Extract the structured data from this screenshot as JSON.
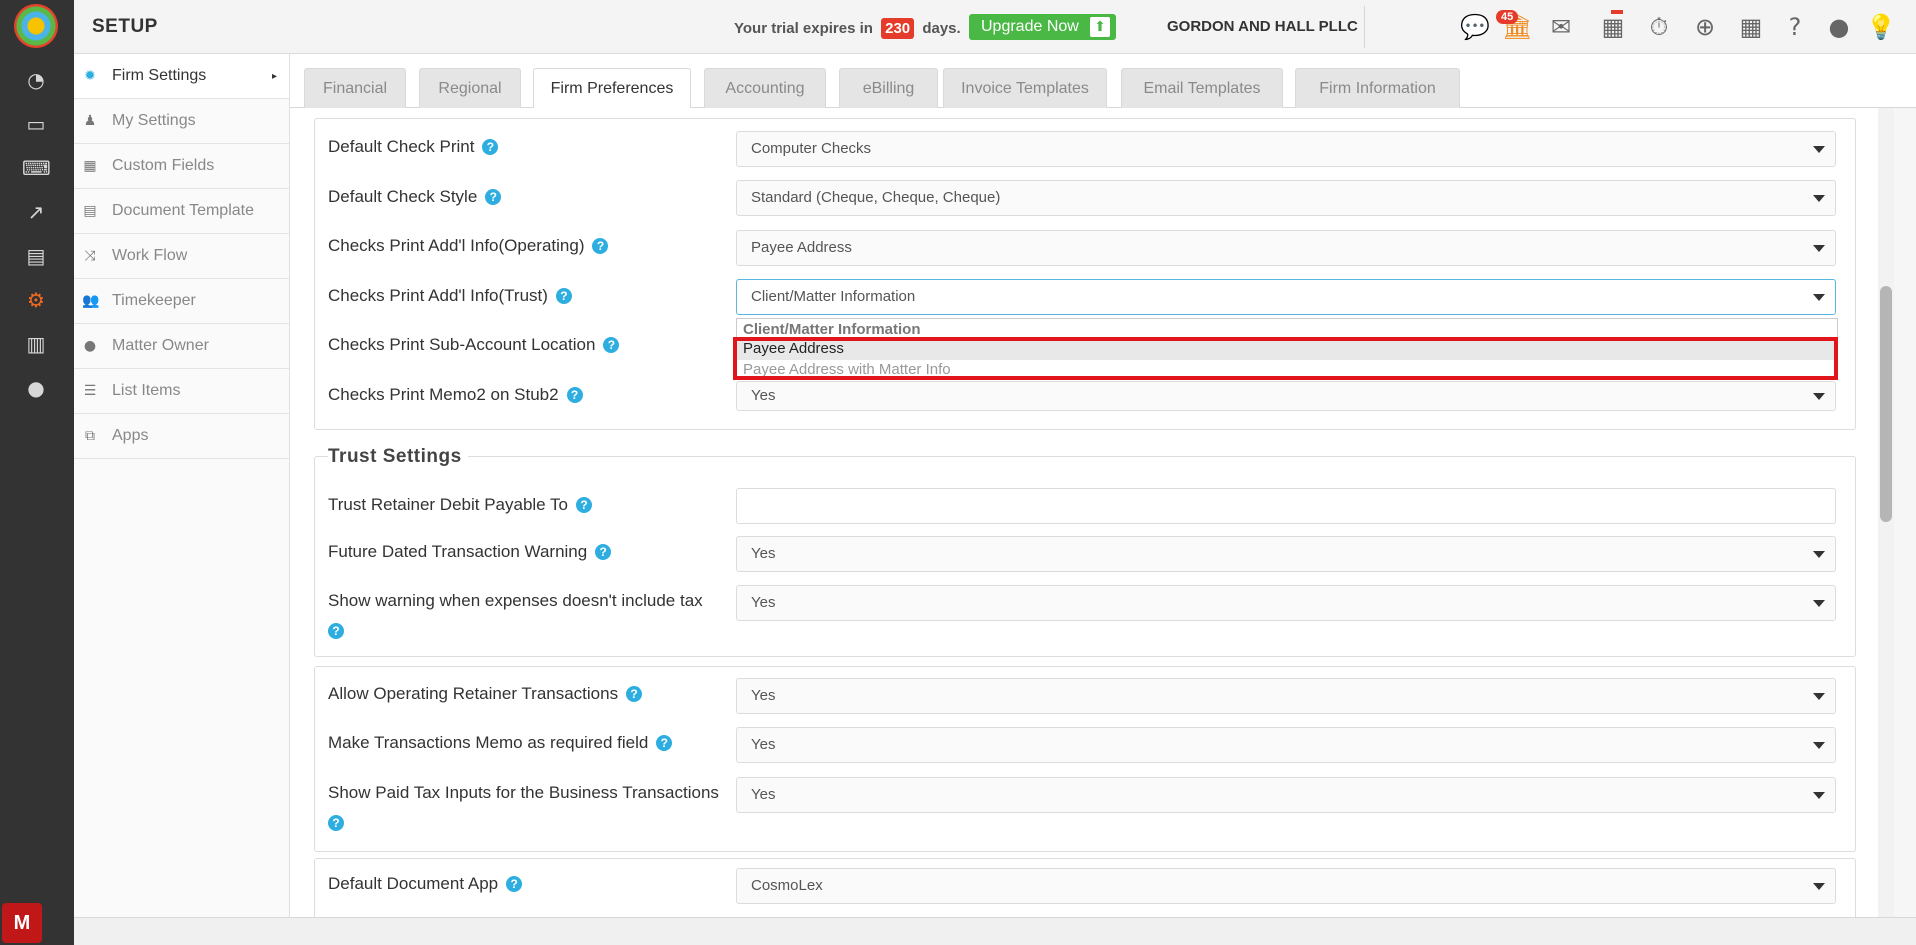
{
  "header": {
    "title": "SETUP",
    "trial_prefix": "Your trial expires in",
    "trial_days": "230",
    "trial_suffix": "days.",
    "upgrade_label": "Upgrade Now",
    "firm_name": "GORDON AND HALL PLLC",
    "mail_count": "45"
  },
  "rail_icons": [
    "dashboard-icon",
    "folder-icon",
    "laptop-icon",
    "chart-icon",
    "book-icon",
    "gears-icon",
    "bar-chart-icon",
    "user-icon"
  ],
  "sidebar": {
    "items": [
      {
        "label": "Firm Settings",
        "icon": "gear-icon"
      },
      {
        "label": "My Settings",
        "icon": "person-icon"
      },
      {
        "label": "Custom Fields",
        "icon": "grid-icon"
      },
      {
        "label": "Document Template",
        "icon": "document-icon"
      },
      {
        "label": "Work Flow",
        "icon": "shuffle-icon"
      },
      {
        "label": "Timekeeper",
        "icon": "users-icon"
      },
      {
        "label": "Matter Owner",
        "icon": "person-icon"
      },
      {
        "label": "List Items",
        "icon": "list-icon"
      },
      {
        "label": "Apps",
        "icon": "copy-icon"
      }
    ]
  },
  "tabs": [
    "Financial",
    "Regional",
    "Firm Preferences",
    "Accounting",
    "eBilling",
    "Invoice Templates",
    "Email Templates",
    "Firm Information"
  ],
  "check_settings": {
    "rows": [
      {
        "label": "Default Check Print",
        "value": "Computer Checks"
      },
      {
        "label": "Default Check Style",
        "value": "Standard (Cheque, Cheque, Cheque)"
      },
      {
        "label": "Checks Print Add'l Info(Operating)",
        "value": "Payee Address"
      },
      {
        "label": "Checks Print Add'l Info(Trust)",
        "value": "Client/Matter Information"
      },
      {
        "label": "Checks Print Sub-Account Location",
        "value": ""
      },
      {
        "label": "Checks Print Memo2 on Stub2",
        "value": "Yes"
      }
    ]
  },
  "dropdown": {
    "options": [
      "Client/Matter Information",
      "Payee Address",
      "Payee Address with Matter Info"
    ]
  },
  "trust_settings": {
    "legend": "Trust Settings",
    "rows": [
      {
        "label": "Trust Retainer Debit Payable To",
        "value": ""
      },
      {
        "label": "Future Dated Transaction Warning",
        "value": "Yes"
      },
      {
        "label": "Show warning when expenses doesn't include tax",
        "value": "Yes"
      }
    ]
  },
  "transactions": {
    "rows": [
      {
        "label": "Allow Operating Retainer Transactions",
        "value": "Yes"
      },
      {
        "label": "Make Transactions Memo as required field",
        "value": "Yes"
      },
      {
        "label": "Show Paid Tax Inputs for the Business Transactions",
        "value": "Yes"
      }
    ]
  },
  "document_app": {
    "label": "Default Document App",
    "value": "CosmoLex"
  }
}
